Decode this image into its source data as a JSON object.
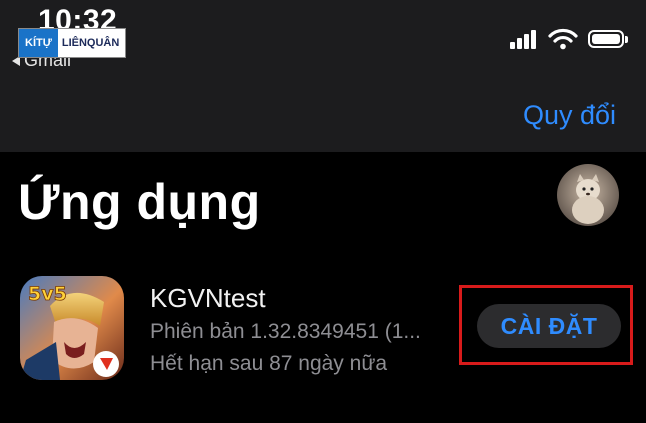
{
  "status_bar": {
    "time": "10:32",
    "back_label": "Gmail"
  },
  "watermark": {
    "left": "KÍTỰ",
    "right": "LIÊNQUÂN"
  },
  "nav": {
    "action_label": "Quy đổi"
  },
  "page": {
    "title": "Ứng dụng"
  },
  "app": {
    "name": "KGVNtest",
    "version": "Phiên bản 1.32.8349451 (1...",
    "expiry": "Hết hạn sau 87 ngày nữa",
    "icon_badge": "5v5",
    "install_label": "CÀI ĐẶT"
  },
  "colors": {
    "accent": "#2f8cff",
    "highlight": "#d81b1b",
    "topbar": "#1c1c1e"
  },
  "icons": [
    "cellular-signal-icon",
    "wifi-icon",
    "battery-icon",
    "back-arrow-icon"
  ]
}
